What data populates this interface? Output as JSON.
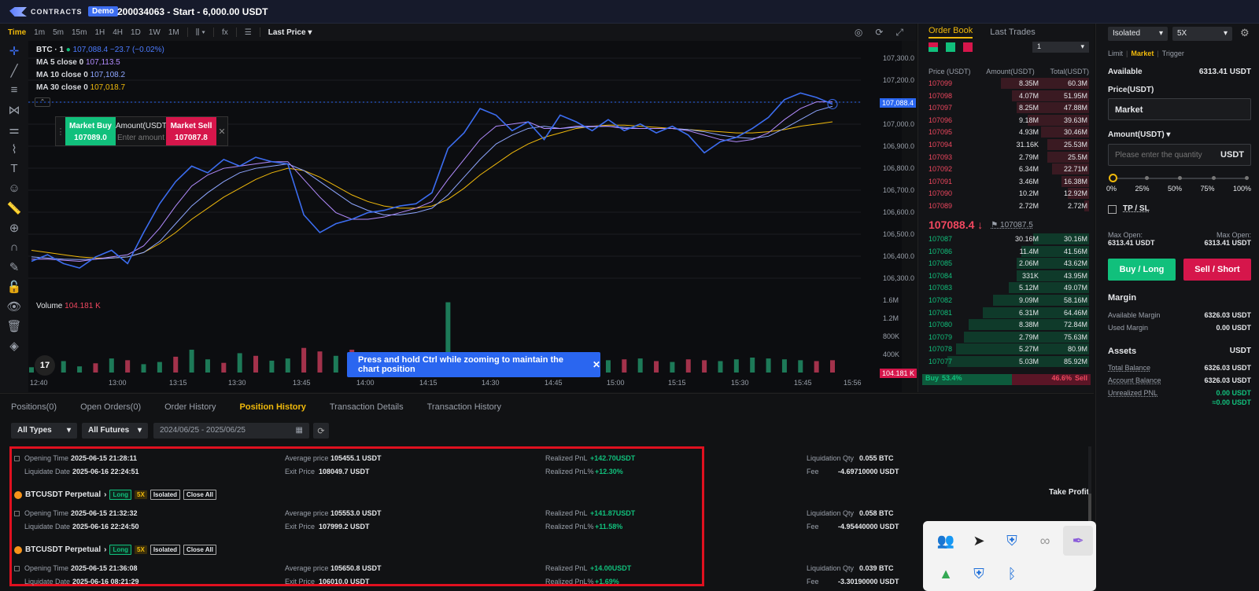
{
  "header": {
    "logo_text": "CONTRACTS",
    "demo_badge": "Demo",
    "account_title": "200034063 - Start - 6,000.00 USDT"
  },
  "chart_toolbar": {
    "timeframes": [
      "Time",
      "1m",
      "5m",
      "15m",
      "1H",
      "4H",
      "1D",
      "1W",
      "1M"
    ],
    "indicator_icon": "fx",
    "price_type": "Last Price"
  },
  "legend": {
    "symbol": "BTC · 1",
    "price": "107,088.4",
    "change": "−23.7 (−0.02%)",
    "ma5_label": "MA 5 close 0",
    "ma5_val": "107,113.5",
    "ma10_label": "MA 10 close 0",
    "ma10_val": "107,108.2",
    "ma30_label": "MA 30 close 0",
    "ma30_val": "107,018.7"
  },
  "quick_trade": {
    "buy_label": "Market Buy",
    "buy_price": "107089.0",
    "amount_label": "Amount(USDT)",
    "amount_placeholder": "Enter amount",
    "sell_label": "Market Sell",
    "sell_price": "107087.8"
  },
  "y_axis": [
    "107,300.0",
    "107,200.0",
    "107,100.0",
    "107,000.0",
    "106,900.0",
    "106,800.0",
    "106,700.0",
    "106,600.0",
    "106,500.0",
    "106,400.0",
    "106,300.0"
  ],
  "vol_axis": [
    "1.6M",
    "1.2M",
    "800K",
    "400K"
  ],
  "x_axis": [
    "12:40",
    "13:00",
    "13:15",
    "13:30",
    "13:45",
    "14:00",
    "14:15",
    "14:30",
    "14:45",
    "15:00",
    "15:15",
    "15:30",
    "15:45",
    "15:56"
  ],
  "last_price_tag": "107,088.4",
  "volume": {
    "label": "Volume",
    "value": "104.181 K",
    "tag": "104.181 K"
  },
  "zoom_tip": "Press and hold Ctrl while zooming to maintain the chart position",
  "tv_logo": "17",
  "chart_data": {
    "type": "line",
    "title": "BTC · 1",
    "ylim": [
      106250,
      107350
    ],
    "series": [
      {
        "name": "Price",
        "color": "#3c6df0",
        "values": [
          106390,
          106420,
          106380,
          106360,
          106410,
          106440,
          106380,
          106520,
          106650,
          106750,
          106820,
          106790,
          106850,
          106820,
          106860,
          106840,
          106830,
          106600,
          106520,
          106560,
          106580,
          106610,
          106620,
          106640,
          106650,
          106700,
          106900,
          106970,
          107080,
          107050,
          106980,
          107020,
          106940,
          107050,
          107020,
          106980,
          107030,
          106980,
          107010,
          106970,
          107000,
          106960,
          106880,
          106930,
          106950,
          106990,
          107040,
          107120,
          107150,
          107130,
          107100
        ]
      },
      {
        "name": "MA 5 close 0",
        "color": "#b38cff",
        "values": [
          106400,
          106400,
          106395,
          106390,
          106400,
          106410,
          106420,
          106460,
          106540,
          106640,
          106730,
          106780,
          106810,
          106820,
          106830,
          106840,
          106840,
          106760,
          106680,
          106610,
          106580,
          106580,
          106590,
          106610,
          106630,
          106660,
          106760,
          106850,
          106940,
          107000,
          107010,
          107020,
          106990,
          106990,
          107000,
          107000,
          107000,
          106990,
          106990,
          106990,
          106990,
          106980,
          106960,
          106940,
          106930,
          106940,
          106970,
          107030,
          107080,
          107110,
          107110
        ]
      },
      {
        "name": "MA 10 close 0",
        "color": "#8ea6ff",
        "values": [
          106410,
          106405,
          106400,
          106398,
          106400,
          106405,
          106410,
          106430,
          106480,
          106560,
          106640,
          106700,
          106750,
          106790,
          106810,
          106820,
          106830,
          106800,
          106750,
          106700,
          106650,
          106620,
          106600,
          106600,
          106610,
          106630,
          106690,
          106770,
          106850,
          106920,
          106960,
          106990,
          107000,
          106990,
          106995,
          106998,
          107000,
          106995,
          106990,
          106990,
          106990,
          106985,
          106975,
          106960,
          106950,
          106945,
          106955,
          106990,
          107030,
          107070,
          107090
        ]
      },
      {
        "name": "MA 30 close 0",
        "color": "#f0b90b",
        "values": [
          106440,
          106430,
          106420,
          106410,
          106405,
          106405,
          106410,
          106430,
          106470,
          106520,
          106580,
          106630,
          106680,
          106720,
          106760,
          106790,
          106810,
          106800,
          106770,
          106730,
          106690,
          106660,
          106640,
          106630,
          106630,
          106640,
          106670,
          106720,
          106780,
          106830,
          106880,
          106920,
          106950,
          106970,
          106990,
          107000,
          107005,
          107005,
          107000,
          106995,
          106990,
          106985,
          106980,
          106975,
          106970,
          106970,
          106975,
          106985,
          107000,
          107010,
          107020
        ]
      }
    ],
    "volume_values": [
      120,
      180,
      260,
      140,
      210,
      320,
      280,
      190,
      240,
      360,
      520,
      300,
      220,
      440,
      380,
      270,
      320,
      560,
      480,
      380,
      520,
      300,
      280,
      260,
      220,
      200,
      1600,
      340,
      260,
      240,
      300,
      260,
      220,
      200,
      240,
      260,
      280,
      300,
      320,
      260,
      240,
      300,
      280,
      260,
      300,
      340,
      320,
      300,
      280,
      260,
      280
    ],
    "volume_colors_up": [
      1,
      0,
      1,
      1,
      0,
      1,
      0,
      1,
      1,
      0,
      1,
      1,
      0,
      1,
      0,
      1,
      1,
      0,
      0,
      1,
      0,
      1,
      1,
      0,
      1,
      1,
      1,
      0,
      1,
      1,
      0,
      1,
      0,
      1,
      1,
      0,
      1,
      0,
      1,
      0,
      1,
      0,
      0,
      1,
      1,
      1,
      1,
      1,
      1,
      0,
      0
    ]
  },
  "orderbook": {
    "tabs": [
      "Order Book",
      "Last Trades"
    ],
    "depth": "1",
    "headers": [
      "Price (USDT)",
      "Amount(USDT)",
      "Total(USDT)"
    ],
    "asks": [
      {
        "price": "107099",
        "amount": "8.35M",
        "total": "60.3M",
        "depth": 0.55
      },
      {
        "price": "107098",
        "amount": "4.07M",
        "total": "51.95M",
        "depth": 0.48
      },
      {
        "price": "107097",
        "amount": "8.25M",
        "total": "47.88M",
        "depth": 0.45
      },
      {
        "price": "107096",
        "amount": "9.18M",
        "total": "39.63M",
        "depth": 0.38
      },
      {
        "price": "107095",
        "amount": "4.93M",
        "total": "30.46M",
        "depth": 0.3
      },
      {
        "price": "107094",
        "amount": "31.16K",
        "total": "25.53M",
        "depth": 0.26
      },
      {
        "price": "107093",
        "amount": "2.79M",
        "total": "25.5M",
        "depth": 0.26
      },
      {
        "price": "107092",
        "amount": "6.34M",
        "total": "22.71M",
        "depth": 0.23
      },
      {
        "price": "107091",
        "amount": "3.46M",
        "total": "16.38M",
        "depth": 0.17
      },
      {
        "price": "107090",
        "amount": "10.2M",
        "total": "12.92M",
        "depth": 0.13
      },
      {
        "price": "107089",
        "amount": "2.72M",
        "total": "2.72M",
        "depth": 0.03
      }
    ],
    "mid_price": "107088.4 ↓",
    "mark_price": "107087.5",
    "bids": [
      {
        "price": "107087",
        "amount": "30.16M",
        "total": "30.16M",
        "depth": 0.35
      },
      {
        "price": "107086",
        "amount": "11.4M",
        "total": "41.56M",
        "depth": 0.42
      },
      {
        "price": "107085",
        "amount": "2.06M",
        "total": "43.62M",
        "depth": 0.45
      },
      {
        "price": "107084",
        "amount": "331K",
        "total": "43.95M",
        "depth": 0.45
      },
      {
        "price": "107083",
        "amount": "5.12M",
        "total": "49.07M",
        "depth": 0.5
      },
      {
        "price": "107082",
        "amount": "9.09M",
        "total": "58.16M",
        "depth": 0.6
      },
      {
        "price": "107081",
        "amount": "6.31M",
        "total": "64.46M",
        "depth": 0.66
      },
      {
        "price": "107080",
        "amount": "8.38M",
        "total": "72.84M",
        "depth": 0.75
      },
      {
        "price": "107079",
        "amount": "2.79M",
        "total": "75.63M",
        "depth": 0.78
      },
      {
        "price": "107078",
        "amount": "5.27M",
        "total": "80.9M",
        "depth": 0.83
      },
      {
        "price": "107077",
        "amount": "5.03M",
        "total": "85.92M",
        "depth": 0.88
      }
    ],
    "buy_label": "Buy",
    "buy_pct": "53.4%",
    "sell_pct": "46.6%",
    "sell_label": "Sell"
  },
  "trade_panel": {
    "margin_mode": "Isolated",
    "leverage": "5X",
    "order_types": [
      "Limit",
      "Market",
      "Trigger"
    ],
    "available_label": "Available",
    "available_value": "6313.41 USDT",
    "price_label": "Price(USDT)",
    "price_value": "Market",
    "amount_label": "Amount(USDT) ▾",
    "amount_placeholder": "Please enter the quantity",
    "amount_unit": "USDT",
    "slider_marks": [
      "0%",
      "25%",
      "50%",
      "75%",
      "100%"
    ],
    "slider_value": 0,
    "tpsl_label": "TP / SL",
    "max_open_label_l": "Max Open:",
    "max_open_value_l": "6313.41 USDT",
    "max_open_label_r": "Max Open:",
    "max_open_value_r": "6313.41 USDT",
    "buy_label": "Buy / Long",
    "sell_label": "Sell / Short",
    "margin_title": "Margin",
    "available_margin_label": "Available Margin",
    "available_margin_value": "6326.03 USDT",
    "used_margin_label": "Used Margin",
    "used_margin_value": "0.00 USDT",
    "assets_title": "Assets",
    "assets_unit": "USDT",
    "total_balance_label": "Total Balance",
    "total_balance_value": "6326.03 USDT",
    "account_balance_label": "Account Balance",
    "account_balance_value": "6326.03 USDT",
    "unrealized_label": "Unrealized PNL",
    "unrealized_value": "0.00 USDT",
    "unrealized_value2": "≈0.00 USDT"
  },
  "bottom": {
    "tabs": [
      "Positions(0)",
      "Open Orders(0)",
      "Order History",
      "Position History",
      "Transaction Details",
      "Transaction History"
    ],
    "type_filter": "All Types",
    "futures_filter": "All Futures",
    "date_range": "2024/06/25 - 2025/06/25",
    "take_profit": "Take Profit",
    "labels": {
      "opening_time": "Opening Time",
      "liquidate_date": "Liquidate Date",
      "avg_price": "Average price",
      "exit_price": "Exit Price",
      "realized_pnl": "Realized PnL",
      "realized_pnl_pct": "Realized PnL%",
      "liq_qty": "Liquidation Qty",
      "fee": "Fee"
    },
    "positions": [
      {
        "symbol": "",
        "opening_time": "2025-06-15 21:28:11",
        "liquidate_date": "2025-06-16 22:24:51",
        "avg_price": "105455.1 USDT",
        "exit_price": "108049.7 USDT",
        "pnl": "+142.70USDT",
        "pnl_pct": "+12.30%",
        "qty": "0.055 BTC",
        "fee": "-4.69710000 USDT"
      },
      {
        "symbol": "BTCUSDT Perpetual",
        "opening_time": "2025-06-15 21:32:32",
        "liquidate_date": "2025-06-16 22:24:50",
        "avg_price": "105553.0 USDT",
        "exit_price": "107999.2 USDT",
        "pnl": "+141.87USDT",
        "pnl_pct": "+11.58%",
        "qty": "0.058 BTC",
        "fee": "-4.95440000 USDT"
      },
      {
        "symbol": "BTCUSDT Perpetual",
        "opening_time": "2025-06-15 21:36:08",
        "liquidate_date": "2025-06-16 08:21:29",
        "avg_price": "105650.8 USDT",
        "exit_price": "106010.0 USDT",
        "pnl": "+14.00USDT",
        "pnl_pct": "+1.69%",
        "qty": "0.039 BTC",
        "fee": "-3.30190000 USDT"
      }
    ],
    "tag_long": "Long",
    "tag_lev": "5X",
    "tag_iso": "Isolated",
    "tag_close": "Close All"
  },
  "tray_icons": [
    "teams-icon",
    "telegram-icon",
    "defender-icon",
    "link-icon",
    "pen-icon",
    "google-drive-icon",
    "security-warning-icon",
    "bluetooth-icon"
  ]
}
